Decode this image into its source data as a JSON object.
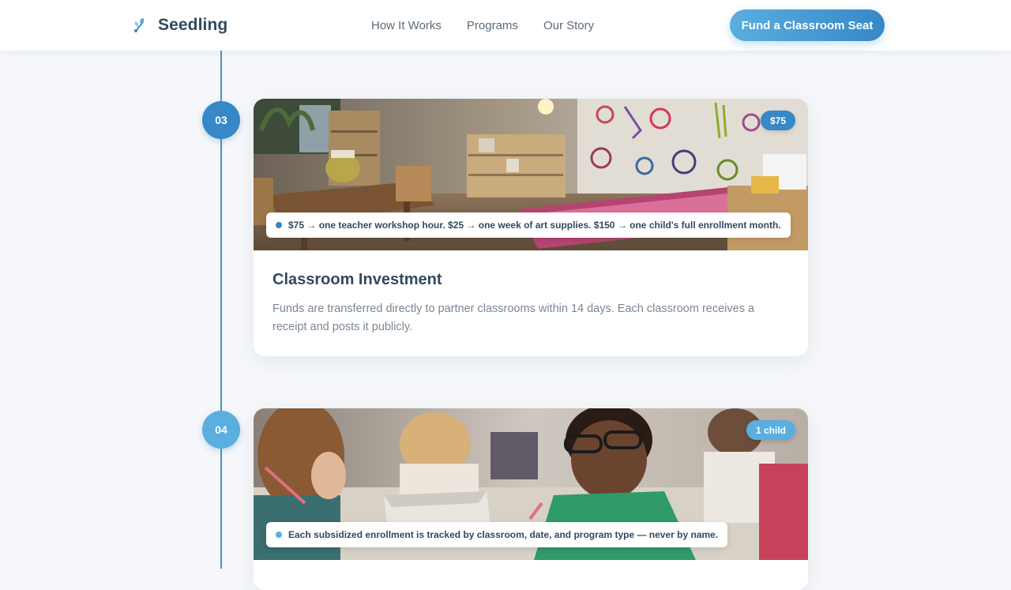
{
  "header": {
    "brand": "Seedling",
    "logo_icon": "seedling-icon",
    "nav": [
      "How It Works",
      "Programs",
      "Our Story"
    ],
    "cta_label": "Fund a Classroom Seat"
  },
  "colors": {
    "accent_dark": "#3688c6",
    "accent_light": "#5aaee0",
    "background": "#f5f7fa",
    "heading": "#34495e",
    "body_text": "#7b8794"
  },
  "timeline": {
    "steps": [
      {
        "number": "03",
        "badge": "$75",
        "caption": "$75 → one teacher workshop hour. $25 → one week of art supplies. $150 → one child's full enrollment month.",
        "title": "Classroom Investment",
        "description": "Funds are transferred directly to partner classrooms within 14 days. Each classroom receives a receipt and posts it publicly.",
        "image": "classroom-photo"
      },
      {
        "number": "04",
        "badge": "1 child",
        "caption": "Each subsidized enrollment is tracked by classroom, date, and program type — never by name.",
        "image": "children-drawing-photo"
      }
    ]
  }
}
